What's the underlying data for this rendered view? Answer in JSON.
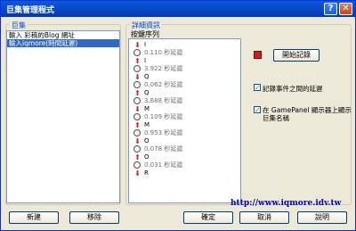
{
  "window": {
    "title": "巨集管理程式"
  },
  "titlebar": {
    "help_glyph": "?",
    "close_glyph": "✕"
  },
  "macros_group": {
    "label": "巨集",
    "items": [
      {
        "label": "輸入 彩稿的Blog 網址",
        "selected": false
      },
      {
        "label": "輸入iqmore(時間延遲)",
        "selected": true
      }
    ]
  },
  "details_group": {
    "label": "詳細資訊",
    "sequence_label": "按鍵序列"
  },
  "sequence": [
    {
      "type": "down",
      "text": "I"
    },
    {
      "type": "delay",
      "text": "0.110 秒延遲"
    },
    {
      "type": "up",
      "text": "I"
    },
    {
      "type": "delay",
      "text": "3.922 秒延遲"
    },
    {
      "type": "down",
      "text": "Q"
    },
    {
      "type": "delay",
      "text": "0.062 秒延遲"
    },
    {
      "type": "up",
      "text": "Q"
    },
    {
      "type": "delay",
      "text": "3.688 秒延遲"
    },
    {
      "type": "down",
      "text": "M"
    },
    {
      "type": "delay",
      "text": "0.109 秒延遲"
    },
    {
      "type": "up",
      "text": "M"
    },
    {
      "type": "delay",
      "text": "0.953 秒延遲"
    },
    {
      "type": "down",
      "text": "O"
    },
    {
      "type": "delay",
      "text": "0.078 秒延遲"
    },
    {
      "type": "up",
      "text": "O"
    },
    {
      "type": "delay",
      "text": "0.031 秒延遲"
    },
    {
      "type": "down",
      "text": "R"
    }
  ],
  "options": {
    "record_button": "開始記錄",
    "record_delays": {
      "label": "記錄事件之間的延遲",
      "checked": true
    },
    "show_macro_name": {
      "label_line1": "在 GamePanel 顯示器上顯示",
      "label_line2": "巨集名稱",
      "checked": true
    },
    "check_glyph": "✓"
  },
  "buttons": {
    "new": "新建",
    "delete": "移除",
    "ok": "確定",
    "cancel": "取消",
    "help": "說明"
  },
  "watermark": "http://www.iqmore.idv.tw"
}
